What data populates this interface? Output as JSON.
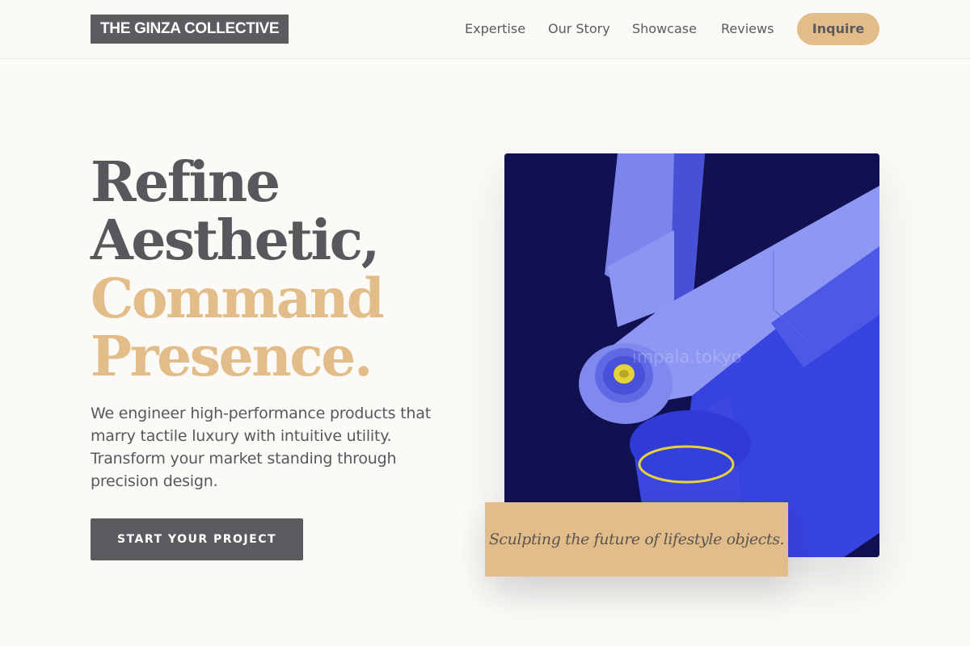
{
  "header": {
    "logo": "THE GINZA COLLECTIVE",
    "nav": [
      "Expertise",
      "Our Story",
      "Showcase",
      "Reviews"
    ],
    "cta": "Inquire"
  },
  "hero": {
    "headline_lines": [
      "Refine",
      "Aesthetic,",
      "Command",
      "Presence."
    ],
    "description": "We engineer high-performance products that marry tactile luxury with intuitive utility. Transform your market standing through precision design.",
    "button": "START YOUR PROJECT",
    "image_watermark": "impala.tokyo",
    "caption": "Sculpting the future of lifestyle objects."
  },
  "colors": {
    "accent_gold": "#e3bd89",
    "dark_gray": "#5c5b5f",
    "background": "#fbfaf7",
    "image_navy": "#111151",
    "image_blue": "#4a56e3"
  }
}
